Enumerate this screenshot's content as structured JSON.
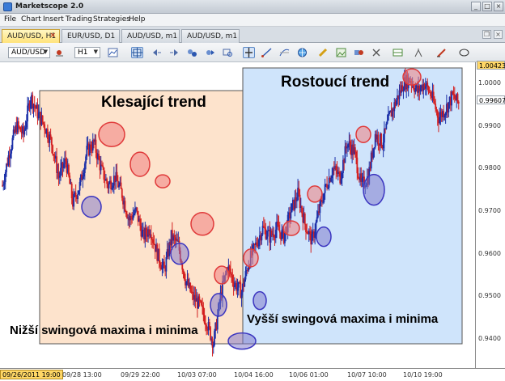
{
  "window": {
    "title": "Marketscope 2.0",
    "btn_min": "_",
    "btn_max": "□",
    "btn_close": "×"
  },
  "menu": [
    "File",
    "Chart",
    "Insert",
    "Trading",
    "Strategies",
    "Help"
  ],
  "tabs": [
    {
      "label": "AUD/USD, H1",
      "active": true
    },
    {
      "label": "EUR/USD, D1",
      "active": false
    },
    {
      "label": "AUD/USD, m1",
      "active": false
    },
    {
      "label": "AUD/USD, m1",
      "active": false
    }
  ],
  "toolbar": {
    "symbol": "AUD/USD",
    "timeframe": "H1"
  },
  "annotations": {
    "down_title": "Klesající trend",
    "up_title": "Rostoucí trend",
    "down_caption": "Nižší swingová maxima i minima",
    "up_caption": "Vyšší swingová maxima i minima"
  },
  "colors": {
    "down_region": "#fde3cc",
    "up_region": "#cfe4fb",
    "bull_candle": "#1b2fa8",
    "bear_candle": "#d42020",
    "high_marker": "#f08080",
    "low_marker": "#7b73c9",
    "current_price_tag": "#ffd766",
    "top_price_tag": "#ffd766"
  },
  "price_axis": {
    "labels": [
      "1.0000",
      "0.9900",
      "0.9800",
      "0.9700",
      "0.9600",
      "0.9500",
      "0.9400"
    ],
    "values": [
      1.0,
      0.99,
      0.98,
      0.97,
      0.96,
      0.95,
      0.94
    ],
    "top_price": "1.00423",
    "current_price": "0.99607",
    "top_value": 1.00423,
    "current_value": 0.99607
  },
  "time_axis": {
    "labels": [
      "09/26/2011 19:00",
      "09/28 13:00",
      "09/29 22:00",
      "10/03 07:00",
      "10/04 16:00",
      "10/06 01:00",
      "10/07 10:00",
      "10/10 19:00"
    ]
  },
  "chart_data": {
    "type": "candlestick",
    "symbol": "AUD/USD",
    "timeframe": "H1",
    "ylim": [
      0.937,
      1.005
    ],
    "close_path": [
      0.976,
      0.984,
      0.99,
      0.988,
      0.997,
      0.993,
      0.99,
      0.986,
      0.978,
      0.982,
      0.972,
      0.976,
      0.984,
      0.986,
      0.98,
      0.976,
      0.978,
      0.974,
      0.968,
      0.97,
      0.964,
      0.966,
      0.96,
      0.956,
      0.964,
      0.962,
      0.954,
      0.95,
      0.948,
      0.944,
      0.939,
      0.95,
      0.957,
      0.953,
      0.951,
      0.958,
      0.962,
      0.966,
      0.964,
      0.966,
      0.964,
      0.97,
      0.974,
      0.967,
      0.963,
      0.97,
      0.976,
      0.98,
      0.978,
      0.986,
      0.984,
      0.976,
      0.978,
      0.988,
      0.986,
      0.992,
      0.996,
      1.0,
      1.001,
      0.998,
      1.0,
      0.997,
      0.992,
      0.994,
      0.997,
      0.995
    ],
    "swing_highs": [
      {
        "time": "09/28",
        "price": 0.988
      },
      {
        "time": "09/29",
        "price": 0.981
      },
      {
        "time": "09/30",
        "price": 0.977
      },
      {
        "time": "10/03",
        "price": 0.967
      },
      {
        "time": "10/04",
        "price": 0.955
      },
      {
        "time": "10/04",
        "price": 0.959
      },
      {
        "time": "10/05",
        "price": 0.966
      },
      {
        "time": "10/06",
        "price": 0.974
      },
      {
        "time": "10/07",
        "price": 0.988
      },
      {
        "time": "10/10",
        "price": 1.0015
      }
    ],
    "swing_lows": [
      {
        "time": "09/28",
        "price": 0.971
      },
      {
        "time": "10/03",
        "price": 0.96
      },
      {
        "time": "10/04",
        "price": 0.948
      },
      {
        "time": "10/04",
        "price": 0.9395
      },
      {
        "time": "10/05",
        "price": 0.949
      },
      {
        "time": "10/06",
        "price": 0.964
      },
      {
        "time": "10/07",
        "price": 0.975
      }
    ]
  }
}
